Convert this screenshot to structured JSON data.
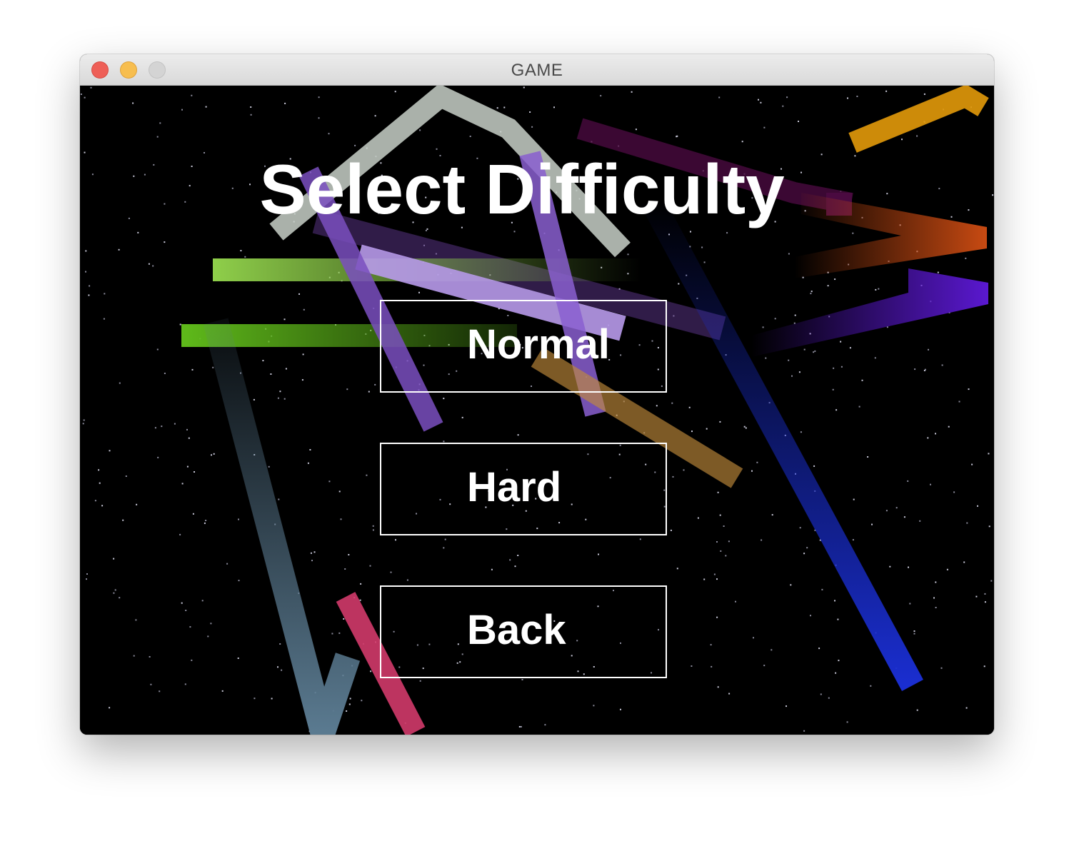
{
  "window": {
    "title": "GAME"
  },
  "screen": {
    "heading": "Select Difficulty"
  },
  "menu": {
    "options": [
      {
        "label": "Normal"
      },
      {
        "label": "Hard"
      },
      {
        "label": "Back"
      }
    ]
  },
  "colors": {
    "background": "#000000",
    "text": "#ffffff",
    "button_border": "#ffffff",
    "streaks": [
      "#c8d0c8",
      "#6a3fa0",
      "#8fcf4a",
      "#5fba1a",
      "#b89aeb",
      "#7a4fc0",
      "#c08a3a",
      "#1a2ed0",
      "#5a7a90",
      "#d23a6a",
      "#e39a0a",
      "#c84a12",
      "#5a18d0",
      "#4a0a40"
    ]
  }
}
